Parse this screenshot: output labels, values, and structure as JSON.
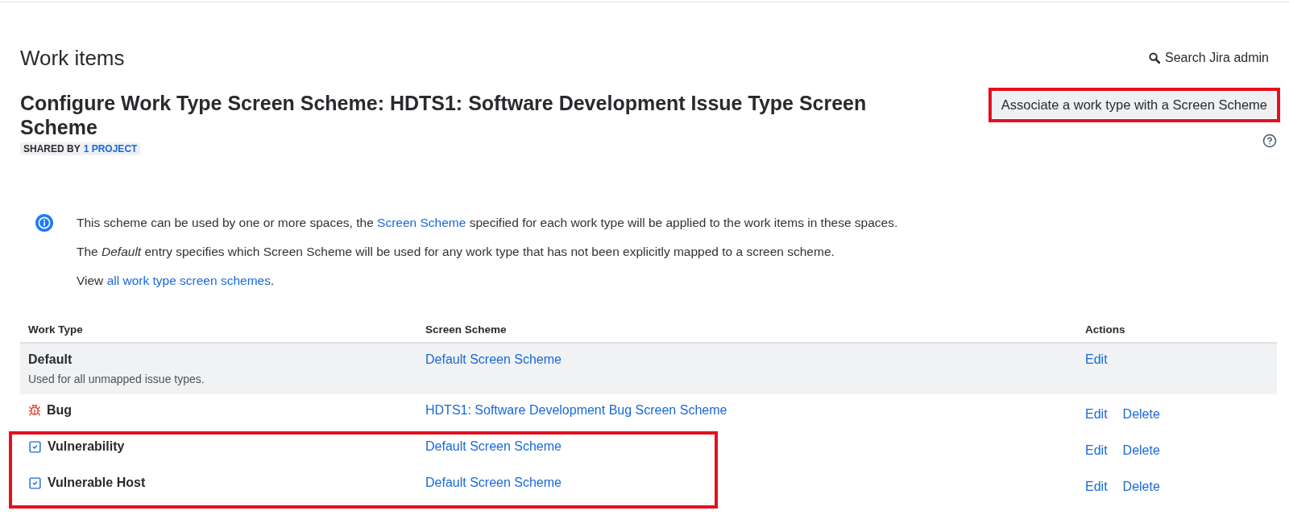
{
  "top_bar": {
    "title": "Work items",
    "search_link": "Search Jira admin"
  },
  "page_header": {
    "title": "Configure Work Type Screen Scheme: HDTS1: Software Development Issue Type Screen Scheme",
    "shared_by": {
      "label": "SHARED BY",
      "link": "1 PROJECT"
    },
    "action_button": {
      "label": "Associate a work type with a Screen Scheme",
      "highlighted": true
    }
  },
  "info": {
    "lines": [
      [
        {
          "kind": "text",
          "text": "This scheme can be used by one or more spaces, the "
        },
        {
          "kind": "link",
          "text": "Screen Scheme"
        },
        {
          "kind": "text",
          "text": " specified for each work type will be applied to the work items in these spaces."
        }
      ],
      [
        {
          "kind": "text",
          "text": "The *Default* entry specifies which Screen Scheme will be used for any work type that has not been explicitly mapped to a screen scheme."
        }
      ],
      [
        {
          "kind": "text",
          "text": "View "
        },
        {
          "kind": "link",
          "text": "all work type screen schemes"
        },
        {
          "kind": "text",
          "text": "."
        }
      ]
    ]
  },
  "table": {
    "columns": [
      "Work Type",
      "Screen Scheme",
      "Actions"
    ],
    "rows": [
      {
        "kind": "default",
        "work_type": "Default",
        "description": "Used for all unmapped issue types.",
        "screen_scheme": "Default Screen Scheme",
        "actions": [
          "Edit"
        ],
        "highlighted": false
      },
      {
        "kind": "bug",
        "work_type": "Bug",
        "screen_scheme": "HDTS1: Software Development Bug Screen Scheme",
        "actions": [
          "Edit",
          "Delete"
        ],
        "highlighted": false
      },
      {
        "kind": "task",
        "work_type": "Vulnerability",
        "screen_scheme": "Default Screen Scheme",
        "actions": [
          "Edit",
          "Delete"
        ],
        "highlighted": true
      },
      {
        "kind": "task",
        "work_type": "Vulnerable Host",
        "screen_scheme": "Default Screen Scheme",
        "actions": [
          "Edit",
          "Delete"
        ],
        "highlighted": true
      }
    ]
  }
}
